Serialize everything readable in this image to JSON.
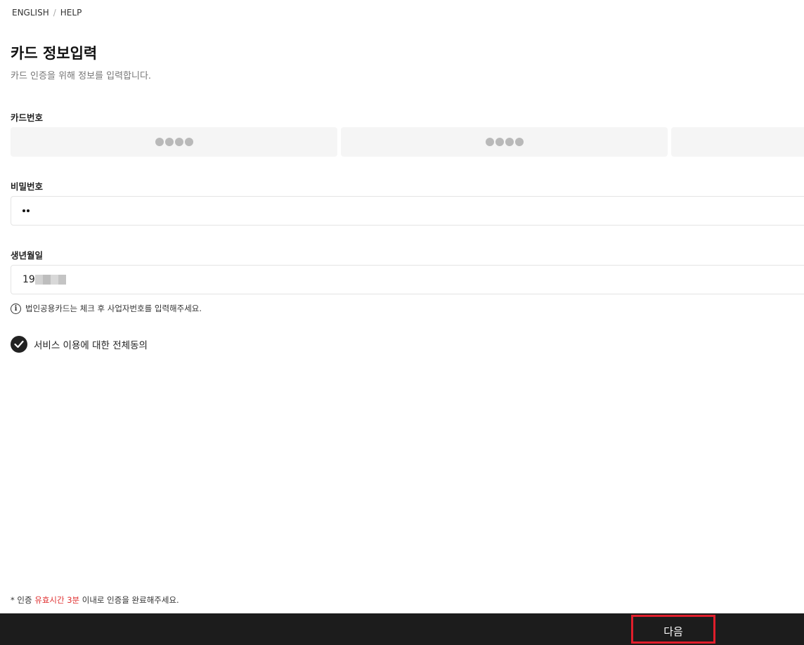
{
  "topnav": {
    "english": "ENGLISH",
    "separator": "/",
    "help": "HELP"
  },
  "header": {
    "title": "카드 정보입력",
    "subtitle": "카드 인증을 위해 정보를 입력합니다."
  },
  "card_number": {
    "label": "카드번호",
    "segments": [
      "●●●●",
      "●●●●",
      ""
    ]
  },
  "password": {
    "label": "비밀번호",
    "value": "••"
  },
  "birthdate": {
    "label": "생년월일",
    "value_visible": "19"
  },
  "notice": {
    "icon": "info-icon",
    "text": "법인공용카드는 체크 후 사업자번호를 입력해주세요."
  },
  "agreement": {
    "label": "서비스 이용에 대한 전체동의",
    "checked": true
  },
  "footnote": {
    "prefix": "* 인증",
    "highlight": "유효시간 3분",
    "suffix": "이내로 인증을 완료해주세요.",
    "highlight_color": "#e03131"
  },
  "bottom_bar": {
    "next_label": "다음",
    "border_color": "#e01e2b"
  }
}
